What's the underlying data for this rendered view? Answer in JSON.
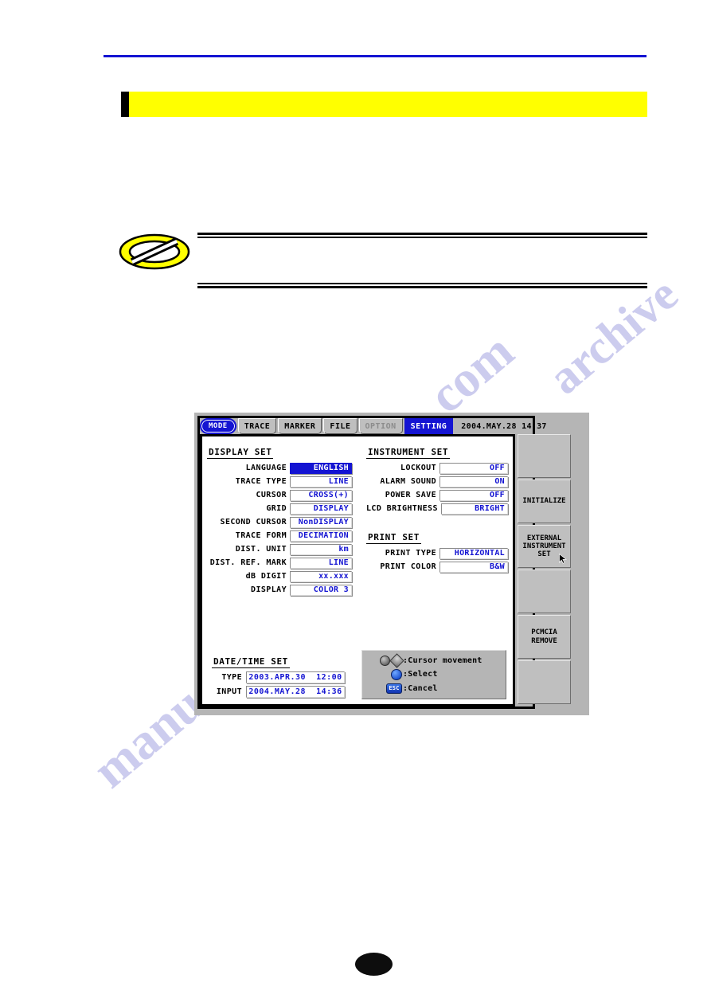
{
  "page": {
    "callout_text": "",
    "note_text": ""
  },
  "device": {
    "tabs": [
      {
        "label": "MODE",
        "state": "mode"
      },
      {
        "label": "TRACE",
        "state": "normal"
      },
      {
        "label": "MARKER",
        "state": "normal"
      },
      {
        "label": "FILE",
        "state": "normal"
      },
      {
        "label": "OPTION",
        "state": "disabled"
      },
      {
        "label": "SETTING",
        "state": "active"
      }
    ],
    "clock": "2004.MAY.28  14:37",
    "display_set": {
      "title": "DISPLAY SET",
      "rows": [
        {
          "label": "LANGUAGE",
          "value": "ENGLISH",
          "selected": true
        },
        {
          "label": "TRACE TYPE",
          "value": "LINE",
          "selected": false
        },
        {
          "label": "CURSOR",
          "value": "CROSS(+)",
          "selected": false
        },
        {
          "label": "GRID",
          "value": "DISPLAY",
          "selected": false
        },
        {
          "label": "SECOND CURSOR",
          "value": "NonDISPLAY",
          "selected": false
        },
        {
          "label": "TRACE FORM",
          "value": "DECIMATION",
          "selected": false
        },
        {
          "label": "DIST. UNIT",
          "value": "km",
          "selected": false
        },
        {
          "label": "DIST. REF. MARK",
          "value": "LINE",
          "selected": false
        },
        {
          "label": "dB DIGIT",
          "value": "xx.xxx",
          "selected": false
        },
        {
          "label": "DISPLAY",
          "value": "COLOR 3",
          "selected": false
        }
      ]
    },
    "instrument_set": {
      "title": "INSTRUMENT SET",
      "rows": [
        {
          "label": "LOCKOUT",
          "value": "OFF",
          "selected": false
        },
        {
          "label": "ALARM SOUND",
          "value": "ON",
          "selected": false
        },
        {
          "label": "POWER SAVE",
          "value": "OFF",
          "selected": false
        },
        {
          "label": "LCD BRIGHTNESS",
          "value": "BRIGHT",
          "selected": false
        }
      ]
    },
    "print_set": {
      "title": "PRINT SET",
      "rows": [
        {
          "label": "PRINT TYPE",
          "value": "HORIZONTAL",
          "selected": false
        },
        {
          "label": "PRINT COLOR",
          "value": "B&W",
          "selected": false
        }
      ]
    },
    "datetime_set": {
      "title": "DATE/TIME SET",
      "rows": [
        {
          "label": "TYPE",
          "value": "2003.APR.30  12:00"
        },
        {
          "label": "INPUT",
          "value": "2004.MAY.28  14:36"
        }
      ]
    },
    "help": {
      "lines": [
        {
          "icons": [
            "knob",
            "knob-diamond"
          ],
          "text": ":Cursor movement"
        },
        {
          "icons": [
            "enter"
          ],
          "text": ":Select"
        },
        {
          "icons": [
            "esc"
          ],
          "text": ":Cancel"
        }
      ],
      "esc_label": "ESC"
    },
    "softkeys": [
      {
        "label": "",
        "cursor": false
      },
      {
        "label": "INITIALIZE",
        "cursor": false
      },
      {
        "label": "EXTERNAL\nINSTRUMENT\nSET",
        "cursor": true
      },
      {
        "label": "",
        "cursor": false
      },
      {
        "label": "PCMCIA\nREMOVE",
        "cursor": false
      },
      {
        "label": "",
        "cursor": false
      }
    ]
  },
  "watermarks": {
    "a": ".com",
    "b": "manual",
    "c": "archive"
  },
  "colors": {
    "accent_blue": "#1414d2",
    "highlight_yellow": "#ffff00",
    "panel_gray": "#b5b5b5"
  }
}
